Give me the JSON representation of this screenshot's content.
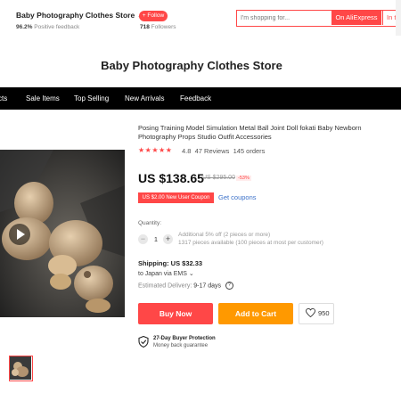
{
  "header": {
    "store_name": "Baby Photography Clothes Store",
    "feedback_value": "96.2%",
    "feedback_label": "Positive feedback",
    "follow_label": "+ Follow",
    "followers_count": "718",
    "followers_label": "Followers"
  },
  "search": {
    "placeholder": "I'm shopping for...",
    "on_aliexpress_label": "On AliExpress",
    "in_store_label": "In th"
  },
  "banner": {
    "title": "Baby Photography Clothes Store"
  },
  "nav": {
    "items": [
      {
        "label": "cts"
      },
      {
        "label": "Sale Items"
      },
      {
        "label": "Top Selling"
      },
      {
        "label": "New Arrivals"
      },
      {
        "label": "Feedback"
      }
    ]
  },
  "product": {
    "title": "Posing Training Model Simulation Metal Ball Joint Doll fokati Baby Newborn Photography Props Studio Outfit Accessories",
    "stars": "★★★★★",
    "rating": "4.8",
    "reviews": "47 Reviews",
    "orders": "145 orders",
    "price": "US $138.65",
    "original_price": "US $295.00",
    "discount": "-53%",
    "coupon_label": "US $2.00 New User Coupon",
    "get_coupons_label": "Get coupons",
    "quantity_label": "Quantity:",
    "quantity_value": "1",
    "quantity_info_1": "Additional 5% off (2 pieces or more)",
    "quantity_info_2": "1317 pieces available (100 pieces at most per customer)",
    "shipping": "Shipping: US $32.33",
    "ship_to": "to Japan via EMS",
    "delivery_label": "Estimated Delivery:",
    "delivery_days": "9-17 days",
    "buy_now_label": "Buy Now",
    "add_cart_label": "Add to Cart",
    "wishlist_count": "950",
    "protection_title": "27-Day Buyer Protection",
    "protection_subtitle": "Money back guarantee"
  },
  "colors": {
    "accent": "#ff4747",
    "cart": "#ff9900",
    "nav_bg": "#000000",
    "link": "#3d72c9"
  },
  "icons": {
    "play": "play-icon",
    "heart": "heart-icon",
    "shield": "shield-check-icon",
    "help": "question-circle-icon",
    "chevron": "chevron-down-icon"
  }
}
